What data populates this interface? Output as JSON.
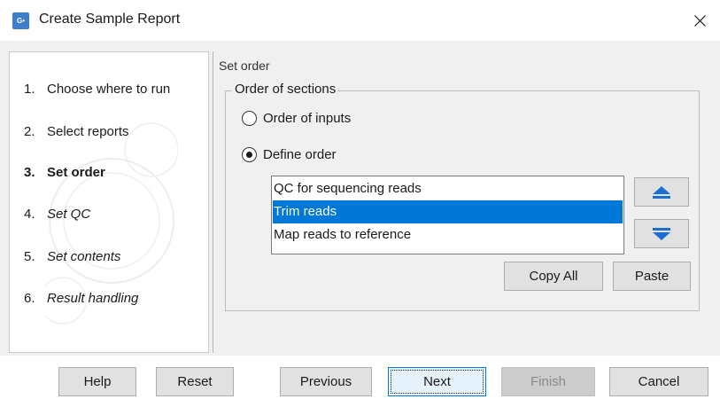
{
  "window": {
    "title": "Create Sample Report",
    "app_icon_text": "G•",
    "app_icon_color": "#3f7fc9"
  },
  "wizard": {
    "steps": [
      {
        "num": "1.",
        "label": "Choose where to run",
        "state": "done"
      },
      {
        "num": "2.",
        "label": "Select reports",
        "state": "done"
      },
      {
        "num": "3.",
        "label": "Set order",
        "state": "current"
      },
      {
        "num": "4.",
        "label": "Set QC",
        "state": "future"
      },
      {
        "num": "5.",
        "label": "Set contents",
        "state": "future"
      },
      {
        "num": "6.",
        "label": "Result handling",
        "state": "future"
      }
    ]
  },
  "content": {
    "heading": "Set order",
    "group_title": "Order of sections",
    "radio_order_of_inputs": {
      "label": "Order of inputs",
      "checked": false
    },
    "radio_define_order": {
      "label": "Define order",
      "checked": true
    },
    "list_items": [
      {
        "label": "QC for sequencing reads",
        "selected": false
      },
      {
        "label": "Trim reads",
        "selected": true
      },
      {
        "label": "Map reads to reference",
        "selected": false
      }
    ],
    "move_up_icon": "arrow-up-icon",
    "move_down_icon": "arrow-down-icon",
    "copy_all_label": "Copy All",
    "paste_label": "Paste"
  },
  "footer": {
    "help_label": "Help",
    "reset_label": "Reset",
    "previous_label": "Previous",
    "next_label": "Next",
    "finish_label": "Finish",
    "cancel_label": "Cancel"
  },
  "colors": {
    "selection": "#0078d7",
    "arrow_icon": "#1a6fd1"
  }
}
